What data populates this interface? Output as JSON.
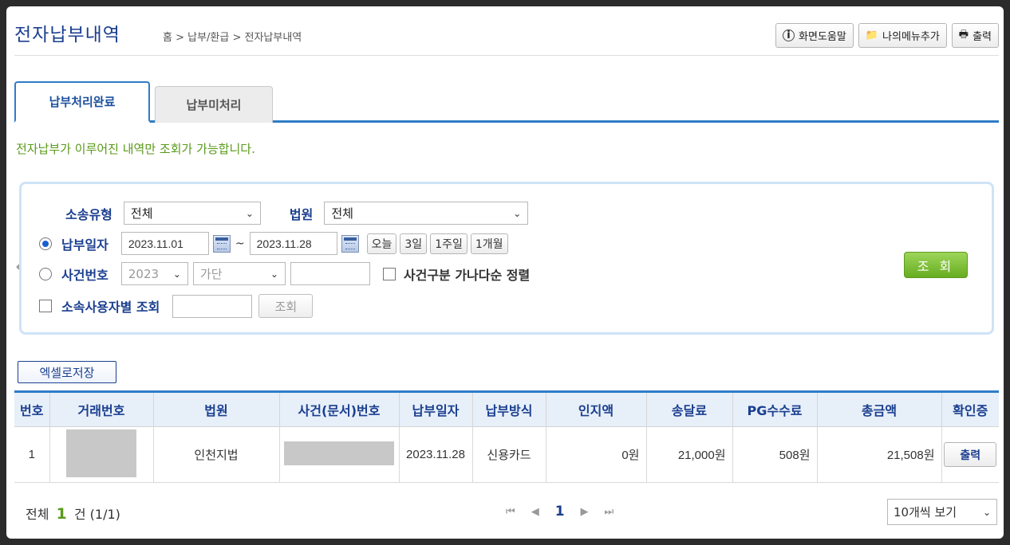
{
  "header": {
    "title": "전자납부내역",
    "breadcrumb": "홈 > 납부/환급 > 전자납부내역",
    "buttons": {
      "help": "화면도움말",
      "add_menu": "나의메뉴추가",
      "print": "출력"
    }
  },
  "tabs": [
    {
      "label": "납부처리완료",
      "active": true
    },
    {
      "label": "납부미처리",
      "active": false
    }
  ],
  "notice": "전자납부가 이루어진 내역만 조회가 가능합니다.",
  "search": {
    "case_type_label": "소송유형",
    "case_type_value": "전체",
    "court_label": "법원",
    "court_value": "전체",
    "pay_date_label": "납부일자",
    "date_from": "2023.11.01",
    "date_to": "2023.11.28",
    "date_sep": "~",
    "quick": [
      "오늘",
      "3일",
      "1주일",
      "1개월"
    ],
    "case_no_label": "사건번호",
    "case_year": "2023",
    "case_kind": "가단",
    "case_number": "",
    "sort_label": "사건구분 가나다순 정렬",
    "user_label": "소속사용자별 조회",
    "user_input": "",
    "user_search": "조회",
    "search_button": "조 회"
  },
  "excel_button": "엑셀로저장",
  "table": {
    "headers": [
      "번호",
      "거래번호",
      "법원",
      "사건(문서)번호",
      "납부일자",
      "납부방식",
      "인지액",
      "송달료",
      "PG수수료",
      "총금액",
      "확인증"
    ],
    "rows": [
      {
        "no": "1",
        "court": "인천지법",
        "date": "2023.11.28",
        "method": "신용카드",
        "stamp": "0원",
        "delivery": "21,000원",
        "pg_fee": "508원",
        "total": "21,508원",
        "receipt": "출력"
      }
    ]
  },
  "footer": {
    "total_prefix": "전체",
    "total_count": "1",
    "total_suffix": "건 (1/1)",
    "current_page": "1",
    "page_size": "10개씩 보기"
  },
  "colors": {
    "brand": "#1b3f8f",
    "accent": "#2e7cc8",
    "green": "#5a9a1a"
  }
}
